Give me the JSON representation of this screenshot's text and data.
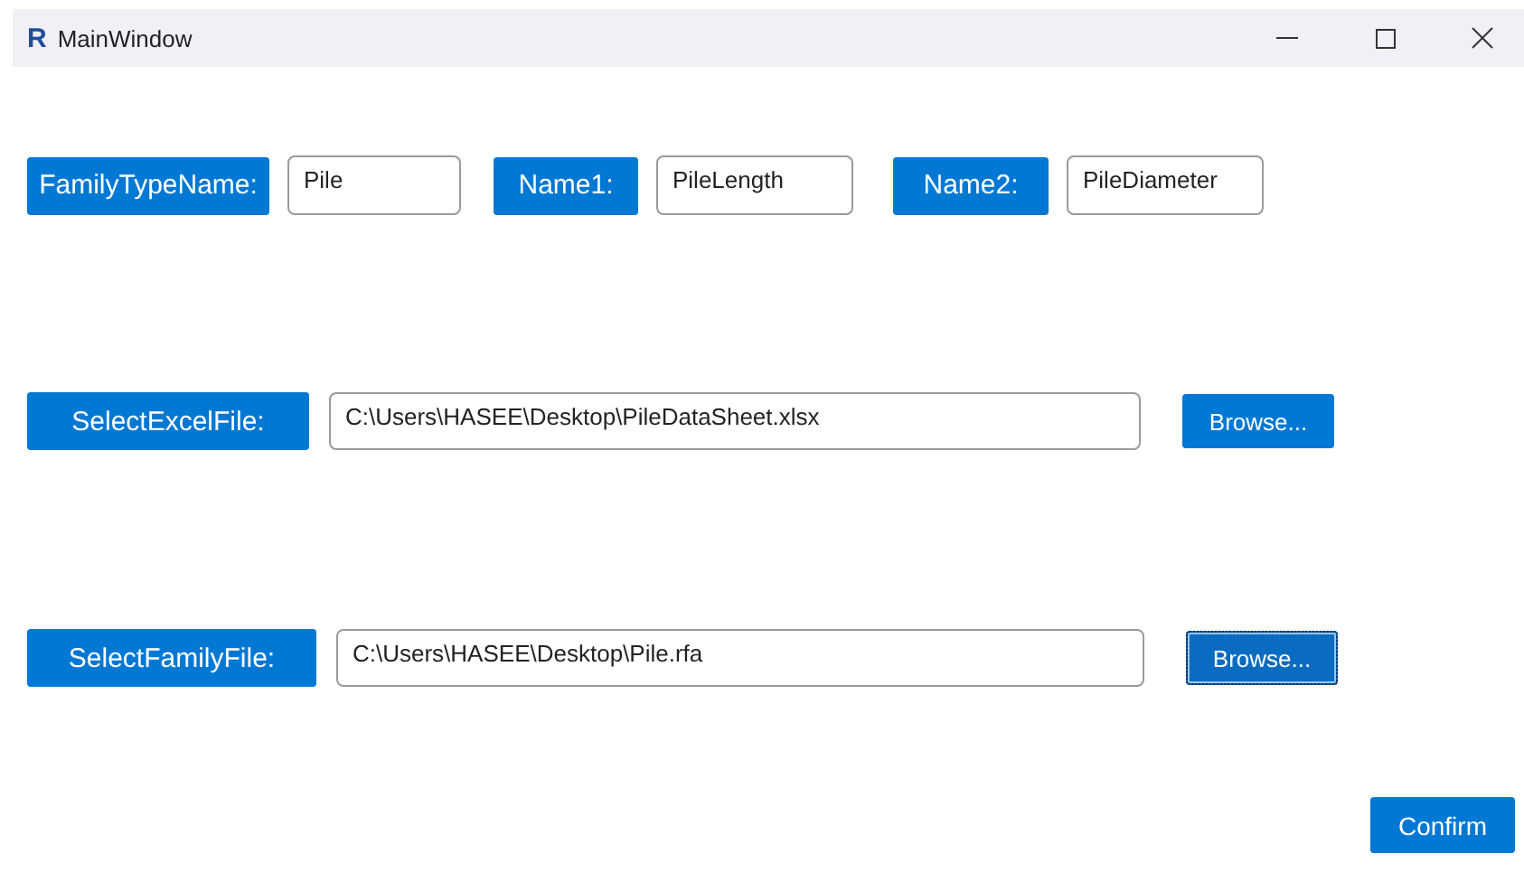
{
  "window": {
    "logo": "R",
    "title": "MainWindow"
  },
  "names_row": [
    {
      "label": "FamilyTypeName:",
      "value": "Pile"
    },
    {
      "label": "Name1:",
      "value": "PileLength"
    },
    {
      "label": "Name2:",
      "value": "PileDiameter"
    }
  ],
  "file_rows": [
    {
      "label": "SelectExcelFile:",
      "value": "C:\\Users\\HASEE\\Desktop\\PileDataSheet.xlsx",
      "button": "Browse...",
      "focused": false
    },
    {
      "label": "SelectFamilyFile:",
      "value": "C:\\Users\\HASEE\\Desktop\\Pile.rfa",
      "button": "Browse...",
      "focused": true
    }
  ],
  "confirm_button": "Confirm"
}
